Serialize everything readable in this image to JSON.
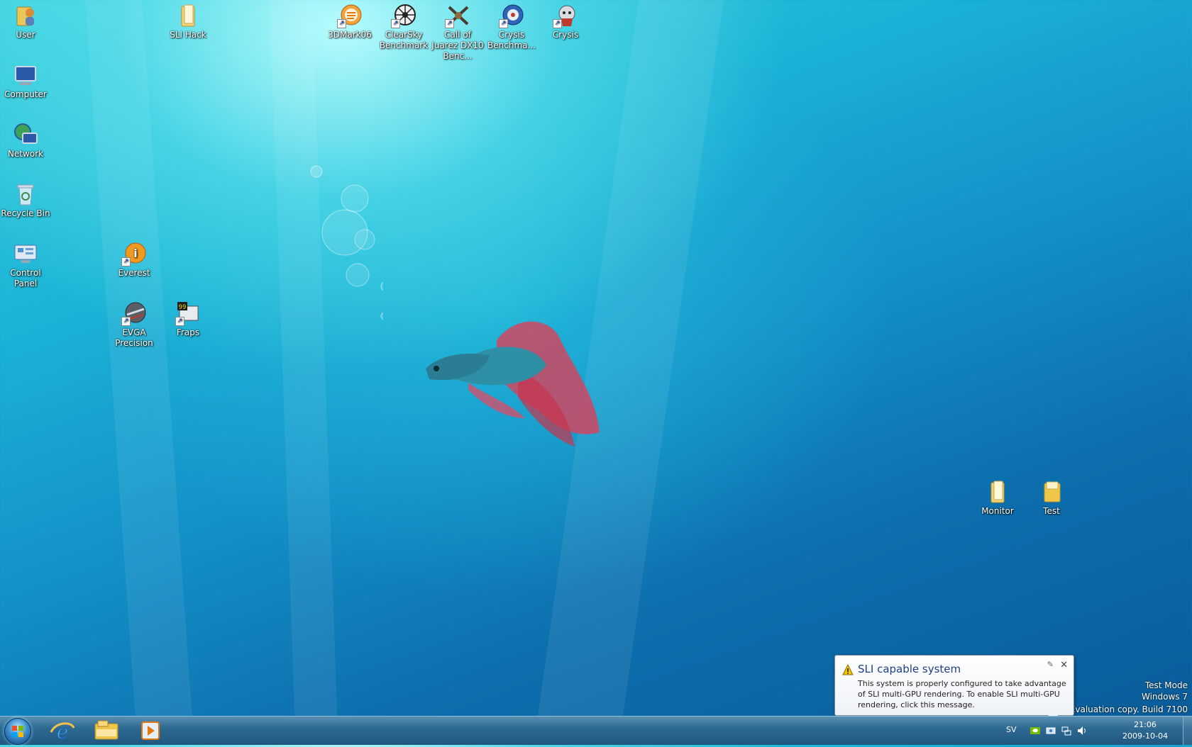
{
  "desktop_icons": {
    "user": "User",
    "computer": "Computer",
    "network": "Network",
    "recycle_bin": "Recycle Bin",
    "control_panel": "Control Panel",
    "sli_hack": "SLI Hack",
    "everest": "Everest",
    "evga_precision": "EVGA Precision",
    "fraps": "Fraps",
    "3dmark06": "3DMark06",
    "clearsky": "ClearSky Benchmark",
    "call_of_juarez": "Call of Juarez DX10 Benc...",
    "crysis_benchmark": "Crysis Benchma...",
    "crysis": "Crysis",
    "monitor": "Monitor",
    "test": "Test"
  },
  "notification": {
    "title": "SLI capable system",
    "message": "This system is properly configured to take advantage of SLI multi-GPU rendering. To enable SLI multi-GPU rendering, click this message."
  },
  "watermark": {
    "line1": "Test Mode",
    "line2": "Windows 7",
    "line3": "Evaluation copy. Build 7100"
  },
  "tray": {
    "language": "SV",
    "time": "21:06",
    "date": "2009-10-04"
  },
  "colors": {
    "taskbar": "#2f6a93",
    "balloon_title": "#1e3f87"
  }
}
